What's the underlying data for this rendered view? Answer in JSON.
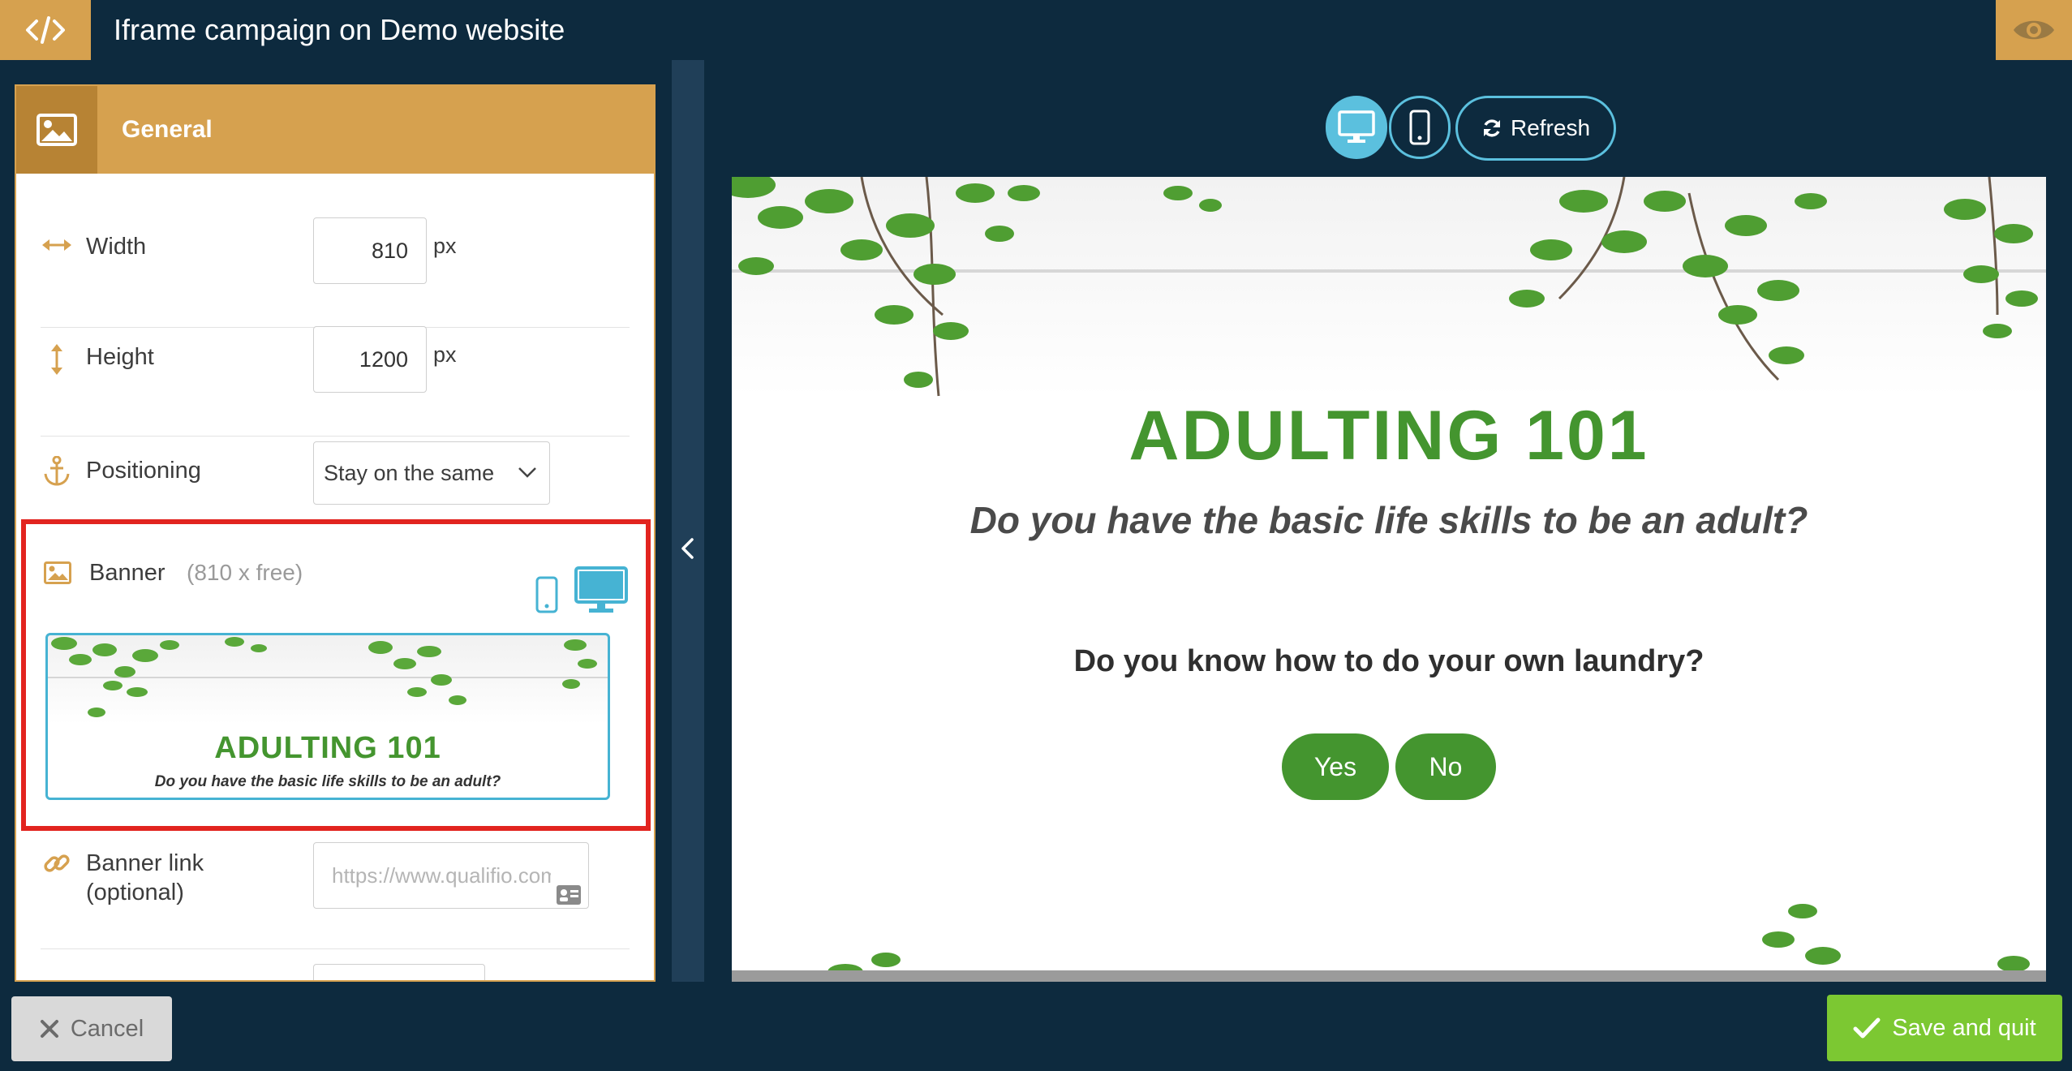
{
  "header": {
    "title": "Iframe campaign on Demo website",
    "code_icon": "code-icon",
    "preview_icon": "eye-icon"
  },
  "panel": {
    "section_title": "General",
    "fields": {
      "width": {
        "label": "Width",
        "value": "810",
        "unit": "px"
      },
      "height": {
        "label": "Height",
        "value": "1200",
        "unit": "px"
      },
      "positioning": {
        "label": "Positioning",
        "value": "Stay on the same"
      },
      "banner": {
        "label": "Banner",
        "dimensions": "(810 x free)",
        "thumb_title": "ADULTING 101",
        "thumb_subtitle": "Do you have the basic life skills to be an adult?"
      },
      "banner_link": {
        "label_line1": "Banner link",
        "label_line2": "(optional)",
        "placeholder": "https://www.qualifio.com"
      }
    }
  },
  "preview": {
    "refresh_label": "Refresh",
    "title": "ADULTING 101",
    "subtitle": "Do you have the basic life skills to be an adult?",
    "question": "Do you know how to do your own laundry?",
    "answers": [
      "Yes",
      "No"
    ]
  },
  "footer": {
    "cancel_label": "Cancel",
    "save_label": "Save and quit"
  },
  "colors": {
    "accent_gold": "#d6a14f",
    "background_navy": "#0d2a3e",
    "device_blue": "#5bc0de",
    "green": "#44952f",
    "save_green": "#7cc832",
    "highlight_red": "#e2241f"
  }
}
